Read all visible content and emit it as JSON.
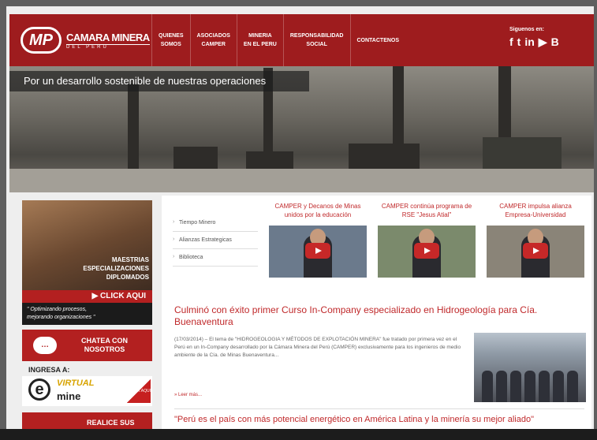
{
  "brand": {
    "name": "CAMARA MINERA",
    "tagline": "DEL PERU",
    "mark": "MP"
  },
  "nav": [
    {
      "label": "QUIENES\nSOMOS"
    },
    {
      "label": "ASOCIADOS\nCAMPER"
    },
    {
      "label": "MINERIA\nEN EL PERU"
    },
    {
      "label": "RESPONSABILIDAD\nSOCIAL"
    },
    {
      "label": "CONTACTENOS"
    }
  ],
  "social": {
    "label": "Siguenos en:",
    "icons": [
      {
        "name": "facebook-icon",
        "glyph": "f"
      },
      {
        "name": "twitter-icon",
        "glyph": "t"
      },
      {
        "name": "linkedin-icon",
        "glyph": "in"
      },
      {
        "name": "youtube-icon",
        "glyph": "▶"
      },
      {
        "name": "blogger-icon",
        "glyph": "B"
      }
    ]
  },
  "banner": {
    "caption": "Por un desarrollo sostenible de nuestras operaciones"
  },
  "sidebar": {
    "promo_text": "MAESTRIAS\nESPECIALIZACIONES\nDIPLOMADOS",
    "promo_cta": "▶ CLICK AQUI",
    "promo_sub": "\" Optimizando procesos,\n mejorando organizaciones \"",
    "chat_label": "CHATEA CON\nNOSOTROS",
    "ingresa": "INGRESA A:",
    "virtual": "VIRTUAL",
    "mine": "mine",
    "click": "CLICK AQUI",
    "realice": "REALICE SUS"
  },
  "sublinks": [
    "Tiempo Minero",
    "Alianzas Estrategicas",
    "Biblioteca"
  ],
  "videos": [
    {
      "caption": "CAMPER y Decanos de Minas unidos por la educación"
    },
    {
      "caption": "CAMPER continúa programa de RSE \"Jesus Atial\""
    },
    {
      "caption": "CAMPER impulsa alianza Empresa-Universidad"
    }
  ],
  "article": {
    "title": "Culminó con éxito primer Curso In-Company especializado en Hidrogeología para Cía. Buenaventura",
    "body": "(17/03/2014) – El tema de \"HIDROGEOLOGIA Y MÉTODOS DE EXPLOTACIÓN MINERA\" fue tratado por primera vez en el Perú en un In-Company desarrollado por la Cámara Minera del Perú (CAMPER) exclusivamente para los ingenieros de medio ambiente de la Cía. de Minas Buenaventura...",
    "more": "» Leer más..."
  },
  "article2": {
    "title": "\"Perú es el país con más potencial energético en América Latina y la minería su mejor aliado\""
  },
  "colors": {
    "brand_red": "#9e1c1e",
    "accent_red": "#c0292b"
  }
}
